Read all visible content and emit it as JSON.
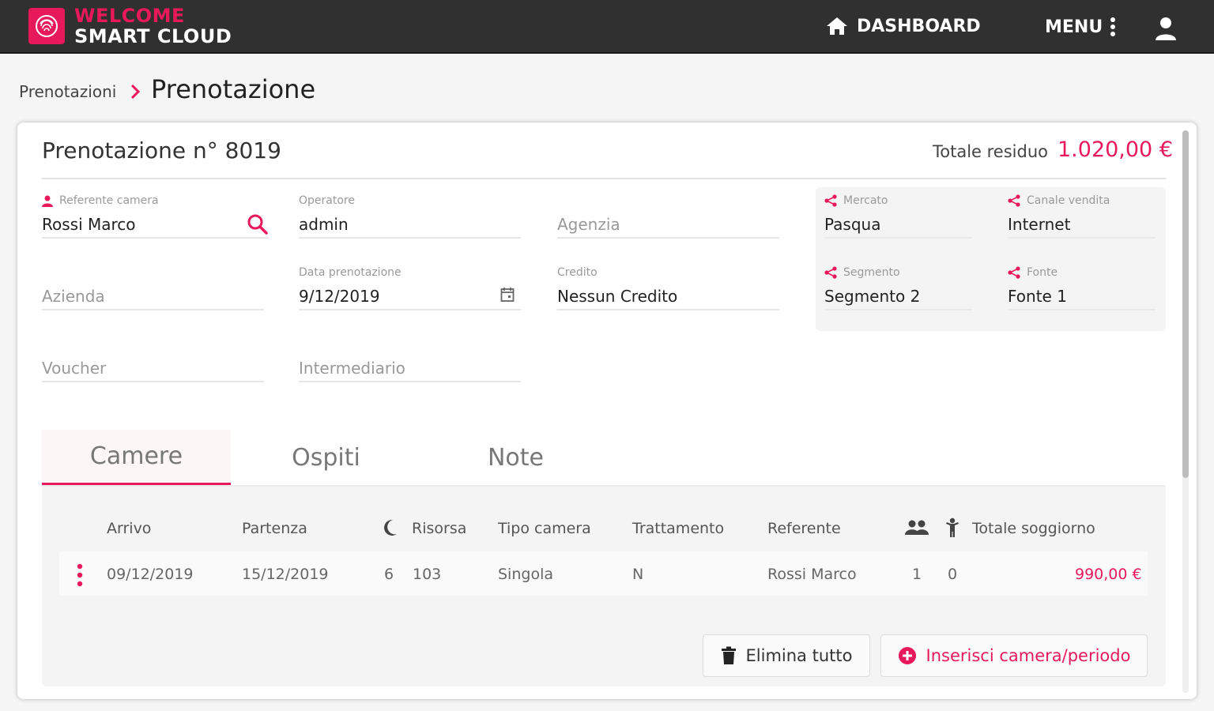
{
  "app": {
    "brand_line1": "WELCOME",
    "brand_line2": "SMART CLOUD",
    "brand_color": "#e8195a"
  },
  "topnav": {
    "dashboard_label": "DASHBOARD",
    "menu_label": "MENU"
  },
  "breadcrumb": {
    "parent": "Prenotazioni",
    "current": "Prenotazione"
  },
  "reservation": {
    "title": "Prenotazione n° 8019",
    "total_label": "Totale residuo",
    "total_value": "1.020,00 €"
  },
  "form": {
    "referente": {
      "label": "Referente camera",
      "value": "Rossi Marco"
    },
    "operatore": {
      "label": "Operatore",
      "value": "admin"
    },
    "agenzia": {
      "placeholder": "Agenzia"
    },
    "azienda": {
      "placeholder": "Azienda"
    },
    "data_prenotazione": {
      "label": "Data prenotazione",
      "value": "9/12/2019"
    },
    "credito": {
      "label": "Credito",
      "value": "Nessun Credito"
    },
    "voucher": {
      "placeholder": "Voucher"
    },
    "intermediario": {
      "placeholder": "Intermediario"
    },
    "mercato": {
      "label": "Mercato",
      "value": "Pasqua"
    },
    "canale": {
      "label": "Canale vendita",
      "value": "Internet"
    },
    "segmento": {
      "label": "Segmento",
      "value": "Segmento 2"
    },
    "fonte": {
      "label": "Fonte",
      "value": "Fonte 1"
    }
  },
  "tabs": [
    {
      "label": "Camere",
      "active": true
    },
    {
      "label": "Ospiti",
      "active": false
    },
    {
      "label": "Note",
      "active": false
    }
  ],
  "table": {
    "headers": {
      "arrivo": "Arrivo",
      "partenza": "Partenza",
      "risorsa": "Risorsa",
      "tipo_camera": "Tipo camera",
      "trattamento": "Trattamento",
      "referente": "Referente",
      "totale": "Totale soggiorno"
    },
    "rows": [
      {
        "arrivo": "09/12/2019",
        "partenza": "15/12/2019",
        "notti": "6",
        "risorsa": "103",
        "tipo_camera": "Singola",
        "trattamento": "N",
        "referente": "Rossi Marco",
        "adulti": "1",
        "bambini": "0",
        "totale": "990,00 €"
      }
    ]
  },
  "actions": {
    "delete_all": "Elimina tutto",
    "insert": "Inserisci camera/periodo"
  }
}
